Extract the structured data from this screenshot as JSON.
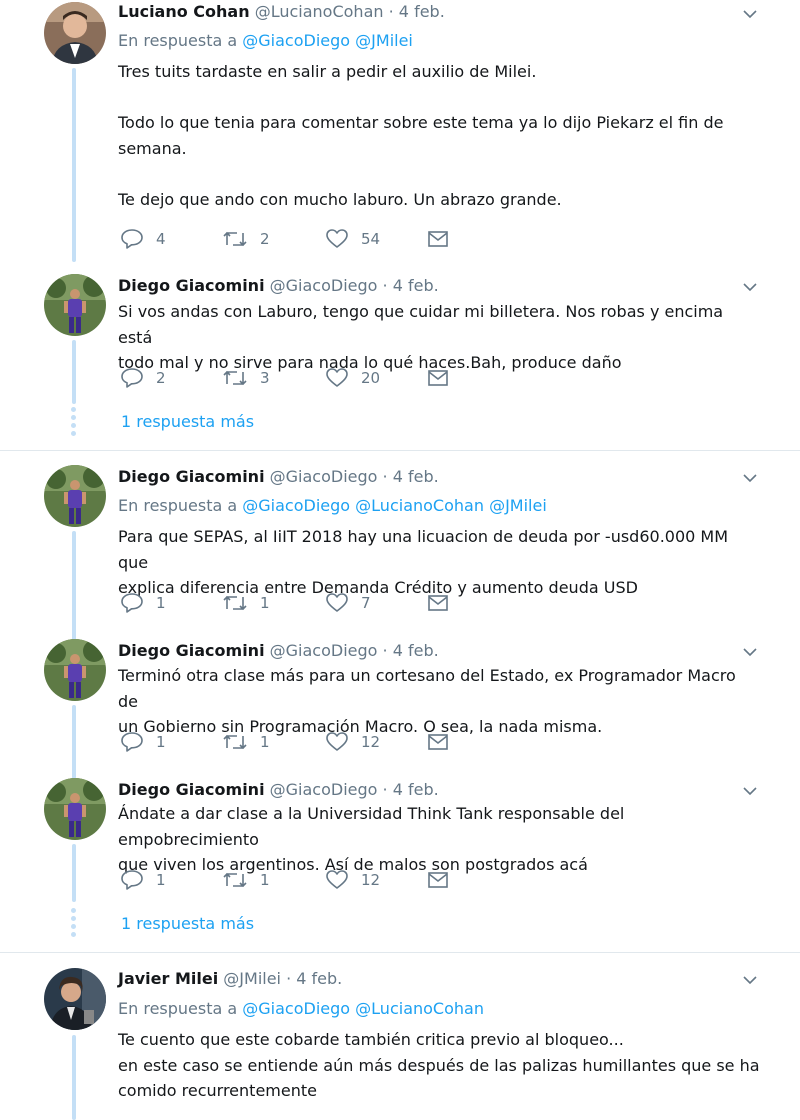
{
  "t1": {
    "name": "Luciano Cohan",
    "handle": "@LucianoCohan",
    "dot": "·",
    "date": "4 feb.",
    "reply_prefix": "En respuesta a",
    "mentions": [
      "@GiacoDiego",
      "@JMilei"
    ],
    "lines": [
      "Tres tuits tardaste en salir a pedir el auxilio de Milei.",
      "",
      "Todo lo que tenia para comentar sobre este tema ya lo dijo Piekarz el fin de",
      "semana.",
      "",
      "Te dejo que ando con mucho laburo. Un abrazo grande."
    ],
    "replies": "4",
    "retweets": "2",
    "likes": "54"
  },
  "t2": {
    "name": "Diego Giacomini",
    "handle": "@GiacoDiego",
    "dot": "·",
    "date": "4 feb.",
    "lines": [
      "Si vos andas con Laburo, tengo que cuidar mi billetera. Nos robas y encima está",
      "todo mal y no sirve para nada lo qué haces.Bah, produce daño"
    ],
    "replies": "2",
    "retweets": "3",
    "likes": "20"
  },
  "more1": "1 respuesta más",
  "t3": {
    "name": "Diego Giacomini",
    "handle": "@GiacoDiego",
    "dot": "·",
    "date": "4 feb.",
    "reply_prefix": "En respuesta a",
    "mentions": [
      "@GiacoDiego",
      "@LucianoCohan",
      "@JMilei"
    ],
    "lines": [
      "Para que SEPAS, al IiIT 2018 hay una licuacion de deuda por -usd60.000 MM que",
      "explica diferencia entre Demanda Crédito y aumento deuda USD"
    ],
    "replies": "1",
    "retweets": "1",
    "likes": "7"
  },
  "t4": {
    "name": "Diego Giacomini",
    "handle": "@GiacoDiego",
    "dot": "·",
    "date": "4 feb.",
    "lines": [
      "Terminó otra clase más para un cortesano del Estado, ex Programador Macro de",
      "un Gobierno sin Programación Macro. O sea, la nada misma."
    ],
    "replies": "1",
    "retweets": "1",
    "likes": "12"
  },
  "t5": {
    "name": "Diego Giacomini",
    "handle": "@GiacoDiego",
    "dot": "·",
    "date": "4 feb.",
    "lines": [
      "Ándate a dar clase a la Universidad Think Tank responsable del empobrecimiento",
      "que viven los argentinos. Así de malos son postgrados acá"
    ],
    "replies": "1",
    "retweets": "1",
    "likes": "12"
  },
  "more2": "1 respuesta más",
  "t6": {
    "name": "Javier Milei",
    "handle": "@JMilei",
    "dot": "·",
    "date": "4 feb.",
    "reply_prefix": "En respuesta a",
    "mentions": [
      "@GiacoDiego",
      "@LucianoCohan"
    ],
    "lines": [
      "Te cuento que este cobarde también critica previo al bloqueo...",
      "en este caso se entiende aún más después de las palizas humillantes que se ha",
      "comido recurrentemente"
    ]
  },
  "colors": {
    "accent": "#1da1f2",
    "muted": "#657786",
    "thread": "#c4dff6",
    "divider": "#e6ecf0"
  },
  "icons": {
    "reply": "reply-icon",
    "retweet": "retweet-icon",
    "like": "heart-icon",
    "dm": "envelope-icon",
    "menu": "chevron-down-icon"
  }
}
